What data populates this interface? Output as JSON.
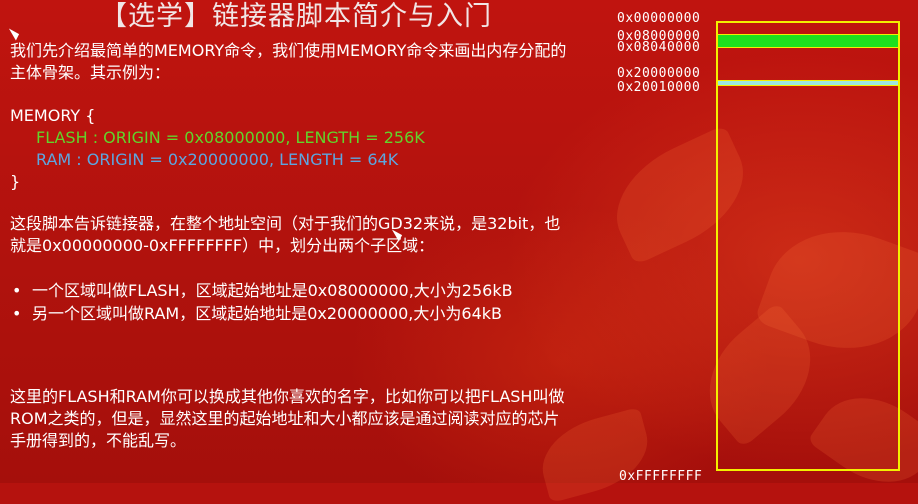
{
  "slide": {
    "title": "【选学】链接器脚本简介与入门",
    "intro": "我们先介绍最简单的MEMORY命令，我们使用MEMORY命令来画出内存分配的主体骨架。其示例为：",
    "code": {
      "open": "MEMORY {",
      "flash_line": "FLASH : ORIGIN = 0x08000000, LENGTH = 256K",
      "ram_line": "RAM : ORIGIN = 0x20000000, LENGTH = 64K",
      "close": "}"
    },
    "description": "这段脚本告诉链接器，在整个地址空间（对于我们的GD32来说，是32bit，也就是0x00000000-0xFFFFFFFF）中，划分出两个子区域：",
    "bullet_marker": "•",
    "bullets": [
      "一个区域叫做FLASH，区域起始地址是0x08000000,大小为256kB",
      "另一个区域叫做RAM，区域起始地址是0x20000000,大小为64kB"
    ],
    "note": "这里的FLASH和RAM你可以换成其他你喜欢的名字，比如你可以把FLASH叫做ROM之类的，但是，显然这里的起始地址和大小都应该是通过阅读对应的芯片手册得到的，不能乱写。"
  },
  "memory_map": {
    "addresses": [
      "0x00000000",
      "0x08000000",
      "0x08040000",
      "0x20000000",
      "0x20010000",
      "0xFFFFFFFF"
    ],
    "colors": {
      "frame": "#f3f000",
      "flash": "#1ee01e",
      "ram": "#9de7e0"
    }
  }
}
